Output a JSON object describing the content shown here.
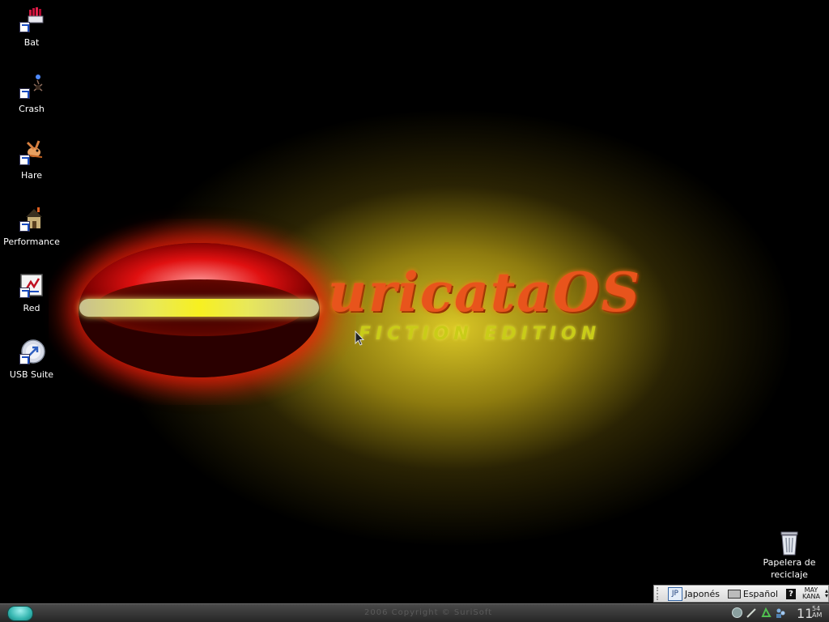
{
  "desktop_icons": [
    {
      "label": "Bat",
      "icon": "bat-launcher-icon"
    },
    {
      "label": "Crash",
      "icon": "crash-launcher-icon"
    },
    {
      "label": "Hare",
      "icon": "hare-launcher-icon"
    },
    {
      "label": "Performance",
      "icon": "performance-launcher-icon"
    },
    {
      "label": "Red",
      "icon": "red-launcher-icon"
    },
    {
      "label": "USB Suite",
      "icon": "usb-suite-launcher-icon"
    }
  ],
  "trash": {
    "label": "Papelera de reciclaje",
    "icon": "trash-icon"
  },
  "wallpaper": {
    "logo_text": "uricataOS",
    "logo_subtitle": "FICTION EDITION",
    "colors": {
      "logo_red": "#e01010",
      "glow_yellow": "#e6d228",
      "background": "#000000"
    }
  },
  "language_bar": {
    "input_badge": "JP",
    "input_language": "Japonés",
    "keyboard_language": "Español",
    "help_symbol": "?",
    "mode_top": "MAY",
    "mode_bottom": "KANA"
  },
  "taskbar": {
    "copyright": "2006 Copyright © SuriSoft",
    "clock_hour": "11",
    "clock_minute": "54",
    "clock_ampm": "AM",
    "tray_icons": [
      "network-icon",
      "pen-icon",
      "recycle-icon",
      "people-icon"
    ]
  }
}
